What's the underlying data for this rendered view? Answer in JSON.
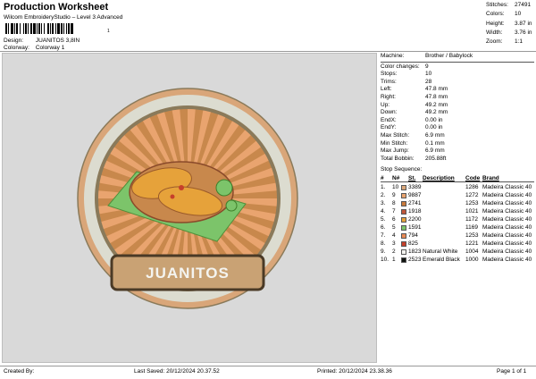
{
  "header": {
    "title": "Production Worksheet",
    "subtitle": "Wilcom EmbroideryStudio – Level 3 Advanced",
    "barcode_number": "1",
    "design_label": "Design:",
    "design_value": "JUANITOS 3,8IN",
    "colorway_label": "Colorway:",
    "colorway_value": "Colorway 1"
  },
  "stats": [
    {
      "label": "Stitches:",
      "value": "27491"
    },
    {
      "label": "Colors:",
      "value": "10"
    },
    {
      "label": "Height:",
      "value": "3.87 in"
    },
    {
      "label": "Width:",
      "value": "3.76 in"
    },
    {
      "label": "Zoom:",
      "value": "1:1"
    }
  ],
  "machine_info": [
    {
      "label": "Machine:",
      "value": "Brother / Babylock"
    },
    {
      "label": "Color changes:",
      "value": "9"
    },
    {
      "label": "Stops:",
      "value": "10"
    },
    {
      "label": "Trims:",
      "value": "28"
    },
    {
      "label": "Left:",
      "value": "47.8 mm"
    },
    {
      "label": "Right:",
      "value": "47.8 mm"
    },
    {
      "label": "Up:",
      "value": "49.2 mm"
    },
    {
      "label": "Down:",
      "value": "49.2 mm"
    },
    {
      "label": "EndX:",
      "value": "0.00 in"
    },
    {
      "label": "EndY:",
      "value": "0.00 in"
    },
    {
      "label": "Max Stitch:",
      "value": "6.9 mm"
    },
    {
      "label": "Min Stitch:",
      "value": "0.1 mm"
    },
    {
      "label": "Max Jump:",
      "value": "6.9 mm"
    },
    {
      "label": "Total Bobbin:",
      "value": "205.88ft"
    }
  ],
  "sequence": {
    "title": "Stop Sequence:",
    "headers": {
      "stop": "#",
      "n": "N#",
      "st": "St.",
      "desc": "Description",
      "code": "Code",
      "brand": "Brand"
    },
    "rows": [
      {
        "stop": "1.",
        "n": "10",
        "color": "#d9a679",
        "st": "3389",
        "desc": "",
        "code": "1286",
        "brand": "Madeira Classic 40"
      },
      {
        "stop": "2.",
        "n": "9",
        "color": "#e9a46f",
        "st": "9887",
        "desc": "",
        "code": "1272",
        "brand": "Madeira Classic 40"
      },
      {
        "stop": "3.",
        "n": "8",
        "color": "#c97a3c",
        "st": "2741",
        "desc": "",
        "code": "1253",
        "brand": "Madeira Classic 40"
      },
      {
        "stop": "4.",
        "n": "7",
        "color": "#c0573a",
        "st": "1918",
        "desc": "",
        "code": "1021",
        "brand": "Madeira Classic 40"
      },
      {
        "stop": "5.",
        "n": "6",
        "color": "#e6a23a",
        "st": "2200",
        "desc": "",
        "code": "1172",
        "brand": "Madeira Classic 40"
      },
      {
        "stop": "6.",
        "n": "5",
        "color": "#7cc46a",
        "st": "1591",
        "desc": "",
        "code": "1169",
        "brand": "Madeira Classic 40"
      },
      {
        "stop": "7.",
        "n": "4",
        "color": "#e98a55",
        "st": "794",
        "desc": "",
        "code": "1253",
        "brand": "Madeira Classic 40"
      },
      {
        "stop": "8.",
        "n": "3",
        "color": "#c6402b",
        "st": "825",
        "desc": "",
        "code": "1221",
        "brand": "Madeira Classic 40"
      },
      {
        "stop": "9.",
        "n": "2",
        "color": "#f4f4f0",
        "st": "1823",
        "desc": "Natural White",
        "code": "1004",
        "brand": "Madeira Classic 40"
      },
      {
        "stop": "10.",
        "n": "1",
        "color": "#111511",
        "st": "2523",
        "desc": "Emerald Black",
        "code": "1000",
        "brand": "Madeira Classic 40"
      }
    ]
  },
  "design": {
    "label_text": "JUANITOS",
    "colors": {
      "outer_ring": "#d9a679",
      "ring_fill": "#dcdcd0",
      "inner_ring": "#8a7a5a",
      "sunburst_base": "#c8884c",
      "ray": "#e9a46f",
      "plate_green": "#7cc46a",
      "taco": "#e6a23a",
      "banner_fill": "#c9a274",
      "banner_border": "#4a3a26",
      "banner_text": "#f4f4f0"
    }
  },
  "footer": {
    "created_label": "Created By:",
    "created_value": "",
    "last_saved_label": "Last Saved:",
    "last_saved_value": "20/12/2024 20.37.52",
    "printed_label": "Printed:",
    "printed_value": "20/12/2024 23.38.36",
    "page": "Page 1 of 1"
  }
}
